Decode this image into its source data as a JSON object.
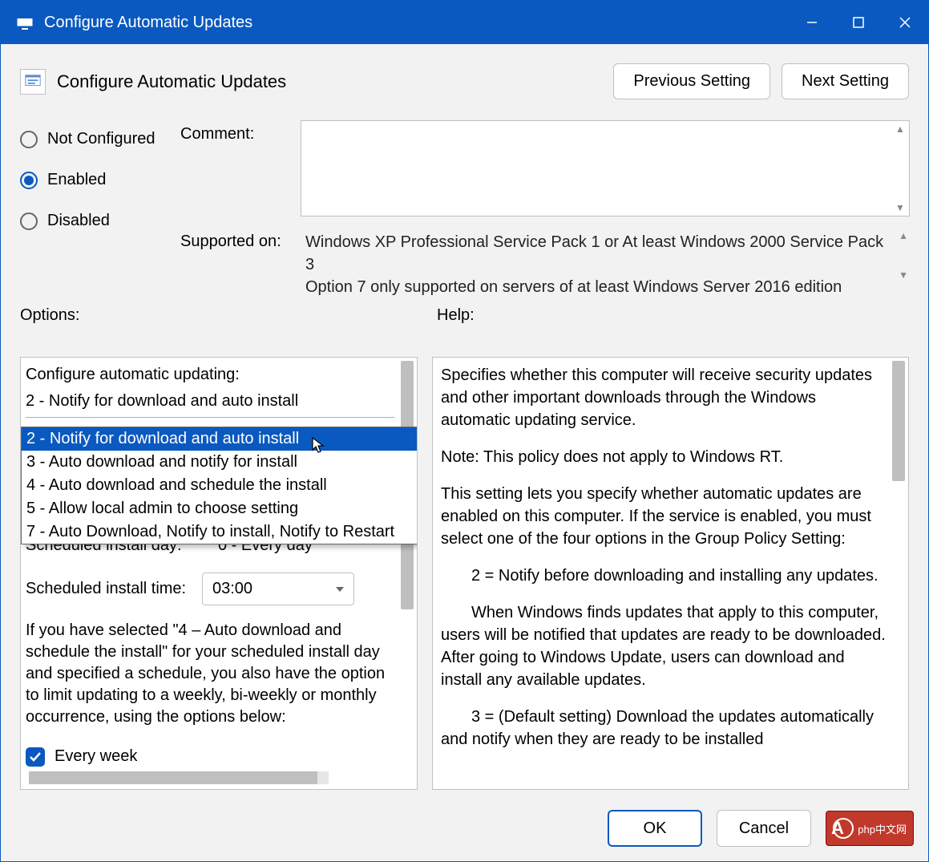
{
  "window": {
    "title": "Configure Automatic Updates"
  },
  "header": {
    "title": "Configure Automatic Updates",
    "prev_label": "Previous Setting",
    "next_label": "Next Setting"
  },
  "state": {
    "not_configured": "Not Configured",
    "enabled": "Enabled",
    "disabled": "Disabled",
    "selected": "enabled",
    "comment_label": "Comment:",
    "supported_label": "Supported on:",
    "supported_text_1": "Windows XP Professional Service Pack 1 or At least Windows 2000 Service Pack 3",
    "supported_text_2": "Option 7 only supported on servers of at least Windows Server 2016 edition"
  },
  "labels": {
    "options": "Options:",
    "help": "Help:"
  },
  "options": {
    "configure_label": "Configure automatic updating:",
    "current_value": "2 - Notify for download and auto install",
    "dropdown": [
      "2 - Notify for download and auto install",
      "3 - Auto download and notify for install",
      "4 - Auto download and schedule the install",
      "5 - Allow local admin to choose setting",
      "7 - Auto Download, Notify to install, Notify to Restart"
    ],
    "dropdown_selected_index": 0,
    "sched_day_label": "Scheduled install day:",
    "sched_day_value": "0 - Every day",
    "sched_time_label": "Scheduled install time:",
    "sched_time_value": "03:00",
    "paragraph": "If you have selected \"4 – Auto download and schedule the install\" for your scheduled install day and specified a schedule, you also have the option to limit updating to a weekly, bi-weekly or monthly occurrence, using the options below:",
    "every_week_label": "Every week",
    "every_week_checked": true
  },
  "help": {
    "p1": "Specifies whether this computer will receive security updates and other important downloads through the Windows automatic updating service.",
    "p2": "Note: This policy does not apply to Windows RT.",
    "p3": "This setting lets you specify whether automatic updates are enabled on this computer. If the service is enabled, you must select one of the four options in the Group Policy Setting:",
    "p4": "2 = Notify before downloading and installing any updates.",
    "p5": "When Windows finds updates that apply to this computer, users will be notified that updates are ready to be downloaded. After going to Windows Update, users can download and install any available updates.",
    "p6": "3 = (Default setting) Download the updates automatically and notify when they are ready to be installed"
  },
  "footer": {
    "ok": "OK",
    "cancel": "Cancel",
    "badge": "php中文网"
  }
}
